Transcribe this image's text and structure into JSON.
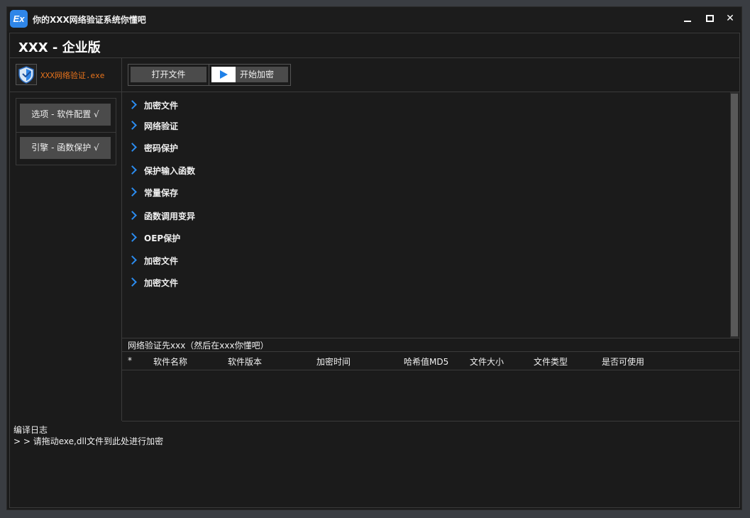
{
  "window": {
    "title": "你的XXX网络验证系统你懂吧",
    "icon_text": "Ex",
    "minimize": "minimize",
    "maximize": "maximize",
    "close_glyph": "✕"
  },
  "header": {
    "title": "XXX - 企业版"
  },
  "logo": {
    "text": "XXX网络验证.exe",
    "icon": "shield-icon"
  },
  "sidebar": {
    "buttons": [
      {
        "label": "选项 - 软件配置 √"
      },
      {
        "label": "引擎 - 函数保护 √"
      }
    ]
  },
  "toolbar": {
    "open_label": "打开文件",
    "start_label": "开始加密"
  },
  "tree": {
    "items": [
      {
        "label": "加密文件"
      },
      {
        "label": "网络验证"
      },
      {
        "label": "密码保护"
      },
      {
        "label": "保护输入函数"
      },
      {
        "label": "常量保存"
      },
      {
        "label": "函数调用变异"
      },
      {
        "label": "OEP保护"
      },
      {
        "label": "加密文件"
      },
      {
        "label": "加密文件"
      }
    ]
  },
  "status": {
    "text": "网络验证先xxx（然后在xxx你懂吧）"
  },
  "table": {
    "columns": [
      "*",
      "软件名称",
      "软件版本",
      "加密时间",
      "哈希值MD5",
      "文件大小",
      "文件类型",
      "是否可使用"
    ]
  },
  "log": {
    "title": "编译日志",
    "lines": [
      "> > 请拖动exe,dll文件到此处进行加密"
    ]
  },
  "colors": {
    "accent": "#2b8cf0",
    "logo_text": "#e8731c",
    "background": "#1b1b1b",
    "button": "#4b4b4b"
  }
}
